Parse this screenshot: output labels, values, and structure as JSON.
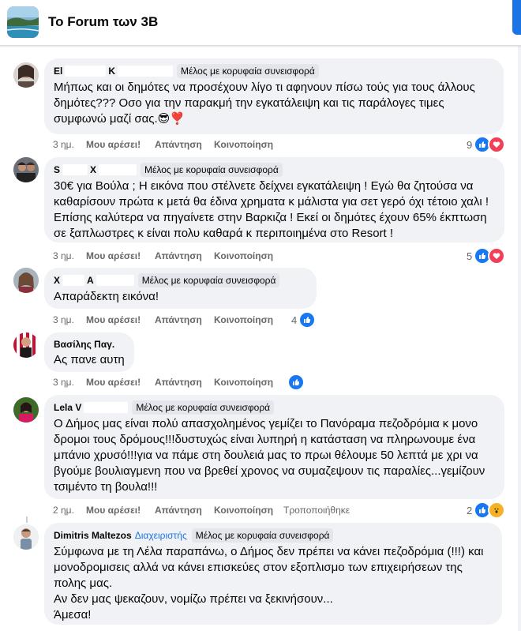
{
  "header": {
    "title": "Το Forum των 3Β"
  },
  "labels": {
    "like": "Μου αρέσει!",
    "reply": "Απάντηση",
    "share": "Κοινοποίηση",
    "edited": "Τροποποιήθηκε",
    "top_contributor": "Μέλος με κορυφαία συνεισφορά",
    "admin": "Διαχειριστής"
  },
  "comments": [
    {
      "author": "El",
      "author_suffix": "K",
      "text": "Μήπως και οι δημότες να προσέχουν λίγο τι αφηνουν πίσω τούς για τους άλλους δημότες??? Οσο για την παρακμή την εγκατάλειψη και τις παράλογες τιμες συμφωνώ μαζί σας.😎❣️",
      "time": "3 ημ.",
      "reaction_count": "9",
      "reactions": [
        "like",
        "love"
      ]
    },
    {
      "author": "S",
      "author_suffix": "X",
      "text": "30€ για Βούλα ; Η εικόνα που στέλνετε δείχνει εγκατάλειψη ! Εγώ θα ζητούσα να καθαρίσουν πρώτα κ μετά θα έδινα χρηματα κ μάλιστα για σετ γερό όχι τέτοιο χαλι ! Επίσης καλύτερα να πηγαίνετε στην Βαρκιζα ! Εκεί οι δημότες έχουν 65% έκπτωση σε ξαπλωστρες κ είναι πολυ καθαρά κ περιποιημένα στο Resort !",
      "time": "3 ημ.",
      "reaction_count": "5",
      "reactions": [
        "like",
        "love"
      ]
    },
    {
      "author": "X",
      "author_suffix": "A",
      "text": "Απαράδεκτη εικόνα!",
      "time": "3 ημ.",
      "reaction_count": "4",
      "reactions": [
        "like"
      ]
    },
    {
      "author": "Βασίλης Παγ.",
      "text": "Ας πανε αυτη",
      "time": "3 ημ.",
      "reaction_count": "",
      "reactions": [
        "like"
      ]
    },
    {
      "author": "Lela V",
      "text": "Ο Δήμος μας είναι πολύ απασχολημένος γεμίζει το Πανόραμα πεζοδρόμια κ μονο δρομοι τους δρόμους!!!δυστυχώς είναι λυπηρή η κατάσταση να πληρωνουμε ένα μπάνιο χρυσό!!!για να πάμε στη δουλειά μας το πρωι θέλουμε 50 λεπτά με χρι να βγούμε βουλιαγμενη που να βρεθεί χρονος να συμαζεψουν τις παραλίες...γεμίζουν τσιμέντο τη βουλα!!!",
      "time": "2 ημ.",
      "reaction_count": "2",
      "reactions": [
        "like",
        "wow"
      ]
    },
    {
      "author": "Dimitris Maltezos",
      "text_lines": [
        "Σύμφωνα με τη Λέλα παραπάνω, ο Δήμος δεν πρέπει να κάνει πεζοδρόμια (!!!) και μονοδρομισεις αλλά να κάνει επισκεύες στον εξοπλισμο των επιχειρήσεων της πολης μας.",
        "Αν δεν μας ψεκαζουν, νομίζω πρέπει να ξεκινήσουν...",
        "Άμεσα!"
      ]
    }
  ],
  "colors": {
    "accent": "#1b74e4",
    "like": "#1877f2",
    "love": "#f33e58",
    "wow": "#f7b125",
    "bubble": "#f0f2f5"
  }
}
